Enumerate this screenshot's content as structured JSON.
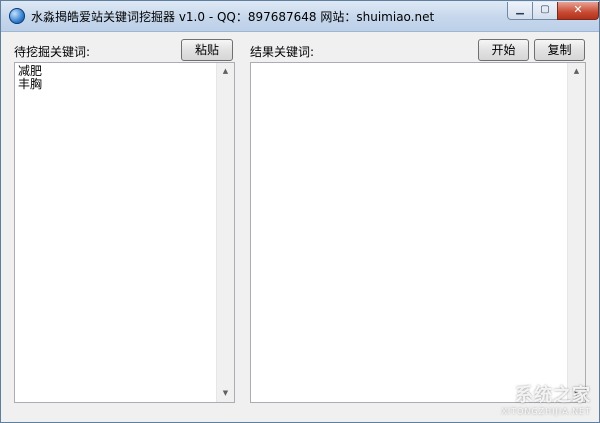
{
  "window": {
    "title": "水淼揭皓爱站关键词挖掘器 v1.0 - QQ：897687648 网站：shuimiao.net",
    "controls": {
      "minimize_glyph": "▁",
      "maximize_glyph": "▢",
      "close_glyph": "✕"
    }
  },
  "left_panel": {
    "label": "待挖掘关键词:",
    "paste_button": "粘贴",
    "keywords_text": "减肥\n丰胸"
  },
  "right_panel": {
    "label": "结果关键词:",
    "start_button": "开始",
    "copy_button": "复制",
    "results_text": ""
  },
  "scrollbar": {
    "up_glyph": "▲",
    "down_glyph": "▼"
  },
  "watermark": {
    "main": "系统之家",
    "sub": "XITONGZHIJIA.NET"
  }
}
